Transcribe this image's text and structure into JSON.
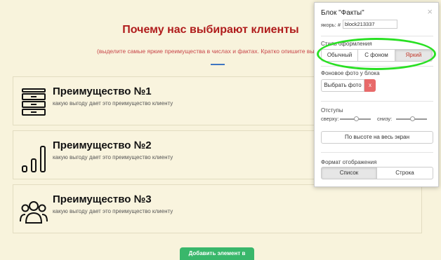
{
  "page": {
    "title": "Почему нас выбирают клиенты",
    "subtitle": "(выделите самые яркие преимущества в числах и фактах. Кратко опишите выгоду клиента)"
  },
  "cards": [
    {
      "title": "Преимущество №1",
      "desc": "какую выгоду дает это преимущество клиенту",
      "icon": "archive-icon"
    },
    {
      "title": "Преимущество №2",
      "desc": "какую выгоду дает это преимущество клиенту",
      "icon": "bar-chart-icon"
    },
    {
      "title": "Преимущество №3",
      "desc": "какую выгоду дает это преимущество клиенту",
      "icon": "users-icon"
    }
  ],
  "add_button_label": "Добавить элемент в список",
  "panel": {
    "title": "Блок \"Факты\"",
    "close": "×",
    "anchor_label": "якорь: #",
    "anchor_value": "block213337",
    "style_label": "Стиль оформления",
    "style_options": [
      "Обычный",
      "С фоном",
      "Яркий"
    ],
    "style_selected": "Яркий",
    "bg_label": "Фоновое фото у блока",
    "bg_button": "Выбрать фото",
    "bg_remove": "x",
    "padding_label": "Отступы",
    "top_label": "сверху:",
    "bottom_label": "снизу:",
    "fullscreen_button": "По высоте на весь экран",
    "format_label": "Формат отображения",
    "format_options": [
      "Список",
      "Строка"
    ],
    "format_selected": "Список"
  },
  "colors": {
    "background": "#f8f3dc",
    "title": "#b01c1c",
    "accent_green": "#39b76b",
    "highlight": "#29e023"
  }
}
